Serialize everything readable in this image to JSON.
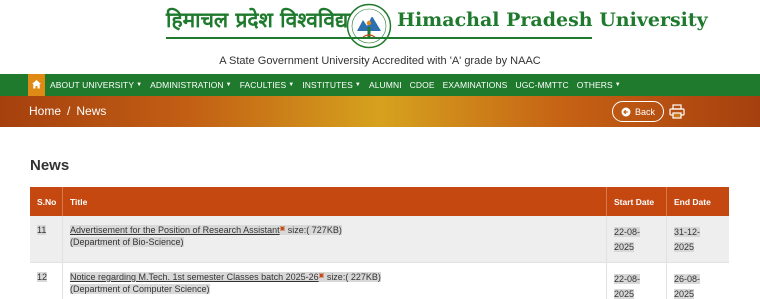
{
  "header": {
    "name_hindi": "हिमाचल प्रदेश विश्वविद्यालय",
    "name_english": "Himachal Pradesh University",
    "tagline": "A State Government University Accredited with 'A' grade by NAAC",
    "brand_color": "#1f7a2e"
  },
  "nav": {
    "home_icon": "home-icon",
    "items": [
      {
        "label": "ABOUT UNIVERSITY",
        "dropdown": true
      },
      {
        "label": "ADMINISTRATION",
        "dropdown": true
      },
      {
        "label": "FACULTIES",
        "dropdown": true
      },
      {
        "label": "INSTITUTES",
        "dropdown": true
      },
      {
        "label": "ALUMNI",
        "dropdown": false
      },
      {
        "label": "CDOE",
        "dropdown": false
      },
      {
        "label": "EXAMINATIONS",
        "dropdown": false
      },
      {
        "label": "UGC-MMTTC",
        "dropdown": false
      },
      {
        "label": "OTHERS",
        "dropdown": true
      }
    ]
  },
  "breadcrumb": {
    "home": "Home",
    "separator": "/",
    "current": "News",
    "back_label": "Back",
    "print_icon": "print-icon"
  },
  "page": {
    "title": "News"
  },
  "table": {
    "header_color": "#c4480f",
    "columns": [
      "S.No",
      "Title",
      "Start Date",
      "End Date"
    ],
    "rows": [
      {
        "sno": "11",
        "title": "Advertisement for the Position of Research Assistant",
        "size": "size:( 727KB)",
        "department": "(Department of Bio-Science)",
        "start_date": "22-08-2025",
        "start_a": "22-08-",
        "start_b": "2025",
        "end_date": "31-12-2025",
        "end_a": "31-12-",
        "end_b": "2025"
      },
      {
        "sno": "12",
        "title": "Notice regarding M.Tech. 1st semester Classes batch 2025-26",
        "size": "size:( 227KB)",
        "department": "(Department of Computer Science)",
        "start_date": "22-08-2025",
        "start_a": "22-08-",
        "start_b": "2025",
        "end_date": "26-08-2025",
        "end_a": "26-08-",
        "end_b": "2025"
      }
    ]
  }
}
